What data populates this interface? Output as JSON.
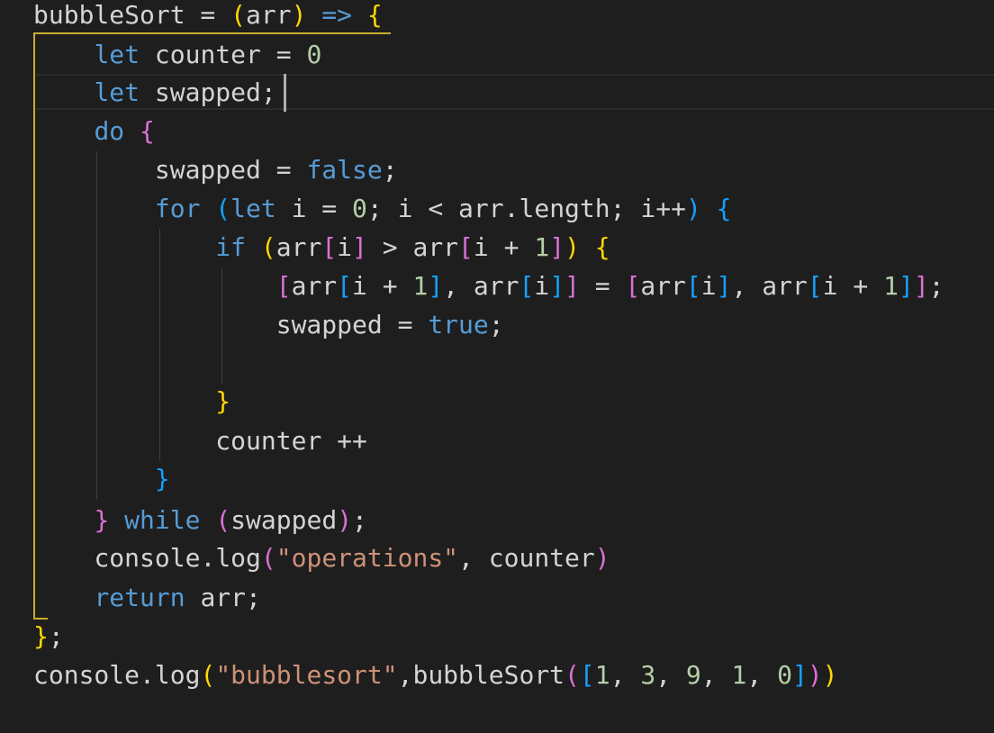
{
  "editor": {
    "lines": [
      "bubbleSort = (arr) => {",
      "    let counter = 0",
      "    let swapped;",
      "    do {",
      "        swapped = false;",
      "        for (let i = 0; i < arr.length; i++) {",
      "            if (arr[i] > arr[i + 1]) {",
      "                [arr[i + 1], arr[i]] = [arr[i], arr[i + 1]];",
      "                swapped = true;",
      "",
      "            }",
      "            counter ++",
      "        }",
      "    } while (swapped);",
      "    console.log(\"operations\", counter)",
      "    return arr;",
      "};",
      "console.log(\"bubblesort\",bubbleSort([1, 3, 9, 1, 0]))"
    ]
  },
  "colors": {
    "background": "#1e1e1e",
    "text": "#d4d4d4",
    "keyword": "#569cd6",
    "number": "#b5cea8",
    "string": "#ce9178",
    "bracket_level_1": "#ffd700",
    "bracket_level_2": "#da70d6",
    "bracket_level_3": "#179fff",
    "active_indent_guide": "#c8ad2c"
  }
}
